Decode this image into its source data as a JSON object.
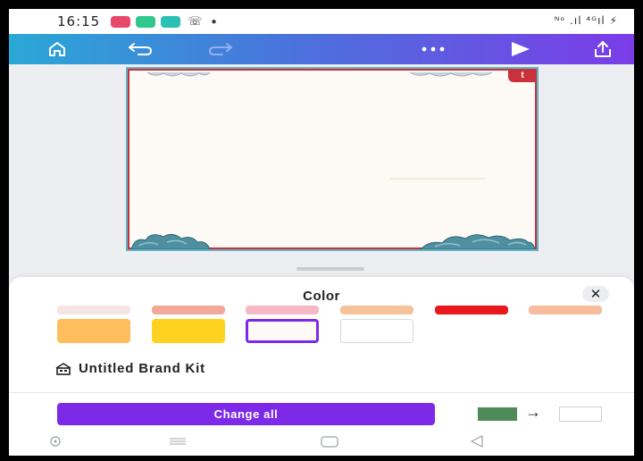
{
  "status_bar": {
    "time": "16:15",
    "right_indicators": "ᴺᵒ .ıl ⁴ᴳıl ⚡"
  },
  "toolbar": {
    "icons": [
      "home-icon",
      "undo-icon",
      "redo-icon",
      "more-icon",
      "play-icon",
      "share-icon"
    ]
  },
  "design": {
    "badge": "t"
  },
  "color_sheet": {
    "title": "Color",
    "close_glyph": "✕",
    "swatches_row1": [
      "#f4e4e6",
      "#f2a99a",
      "#f6b8c4",
      "#f5c29a",
      "#e8191c",
      "#f7bc9b"
    ],
    "swatches_row2": [
      "#ffbe5e",
      "#ffd21f",
      "#fdfaf6",
      "#ffffff"
    ],
    "brand_kit_label": "Untitled Brand Kit",
    "change_all_label": "Change all",
    "from_color": "#4e8b58",
    "to_color": "#ffffff",
    "arrow": "→"
  },
  "colors": {
    "accent": "#7d2ae8",
    "toolbar_gradient_start": "#2aa8d6",
    "toolbar_gradient_end": "#7b3ce8",
    "page_border": "#c9323a"
  }
}
